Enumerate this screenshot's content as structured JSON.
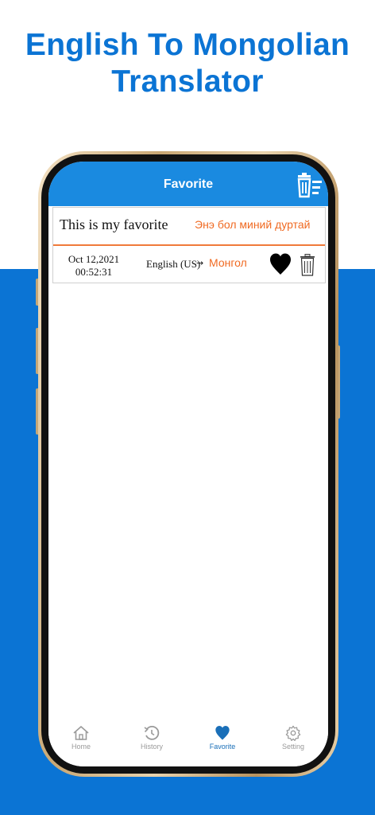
{
  "headline": {
    "line1": "English To Mongolian",
    "line2": "Translator"
  },
  "colors": {
    "brand_blue": "#0b74d4",
    "header_blue": "#1a8ae0",
    "accent_orange": "#f06a22",
    "tab_active": "#1a6fb8",
    "tab_inactive": "#9a9a9a"
  },
  "app": {
    "title": "Favorite",
    "clear_icon": "clear-list-icon"
  },
  "favorites": [
    {
      "source_text": "This is my favorite",
      "translated_text": "Энэ бол миний дуртай",
      "date": "Oct 12,2021",
      "time": "00:52:31",
      "source_lang": "English (US)",
      "arrow": "→",
      "target_lang": "Монгол",
      "favorite_icon": "heart-icon",
      "delete_icon": "trash-icon"
    }
  ],
  "tabs": [
    {
      "label": "Home",
      "icon": "home-icon",
      "active": false
    },
    {
      "label": "History",
      "icon": "history-icon",
      "active": false
    },
    {
      "label": "Favorite",
      "icon": "heart-icon",
      "active": true
    },
    {
      "label": "Setting",
      "icon": "gear-icon",
      "active": false
    }
  ]
}
